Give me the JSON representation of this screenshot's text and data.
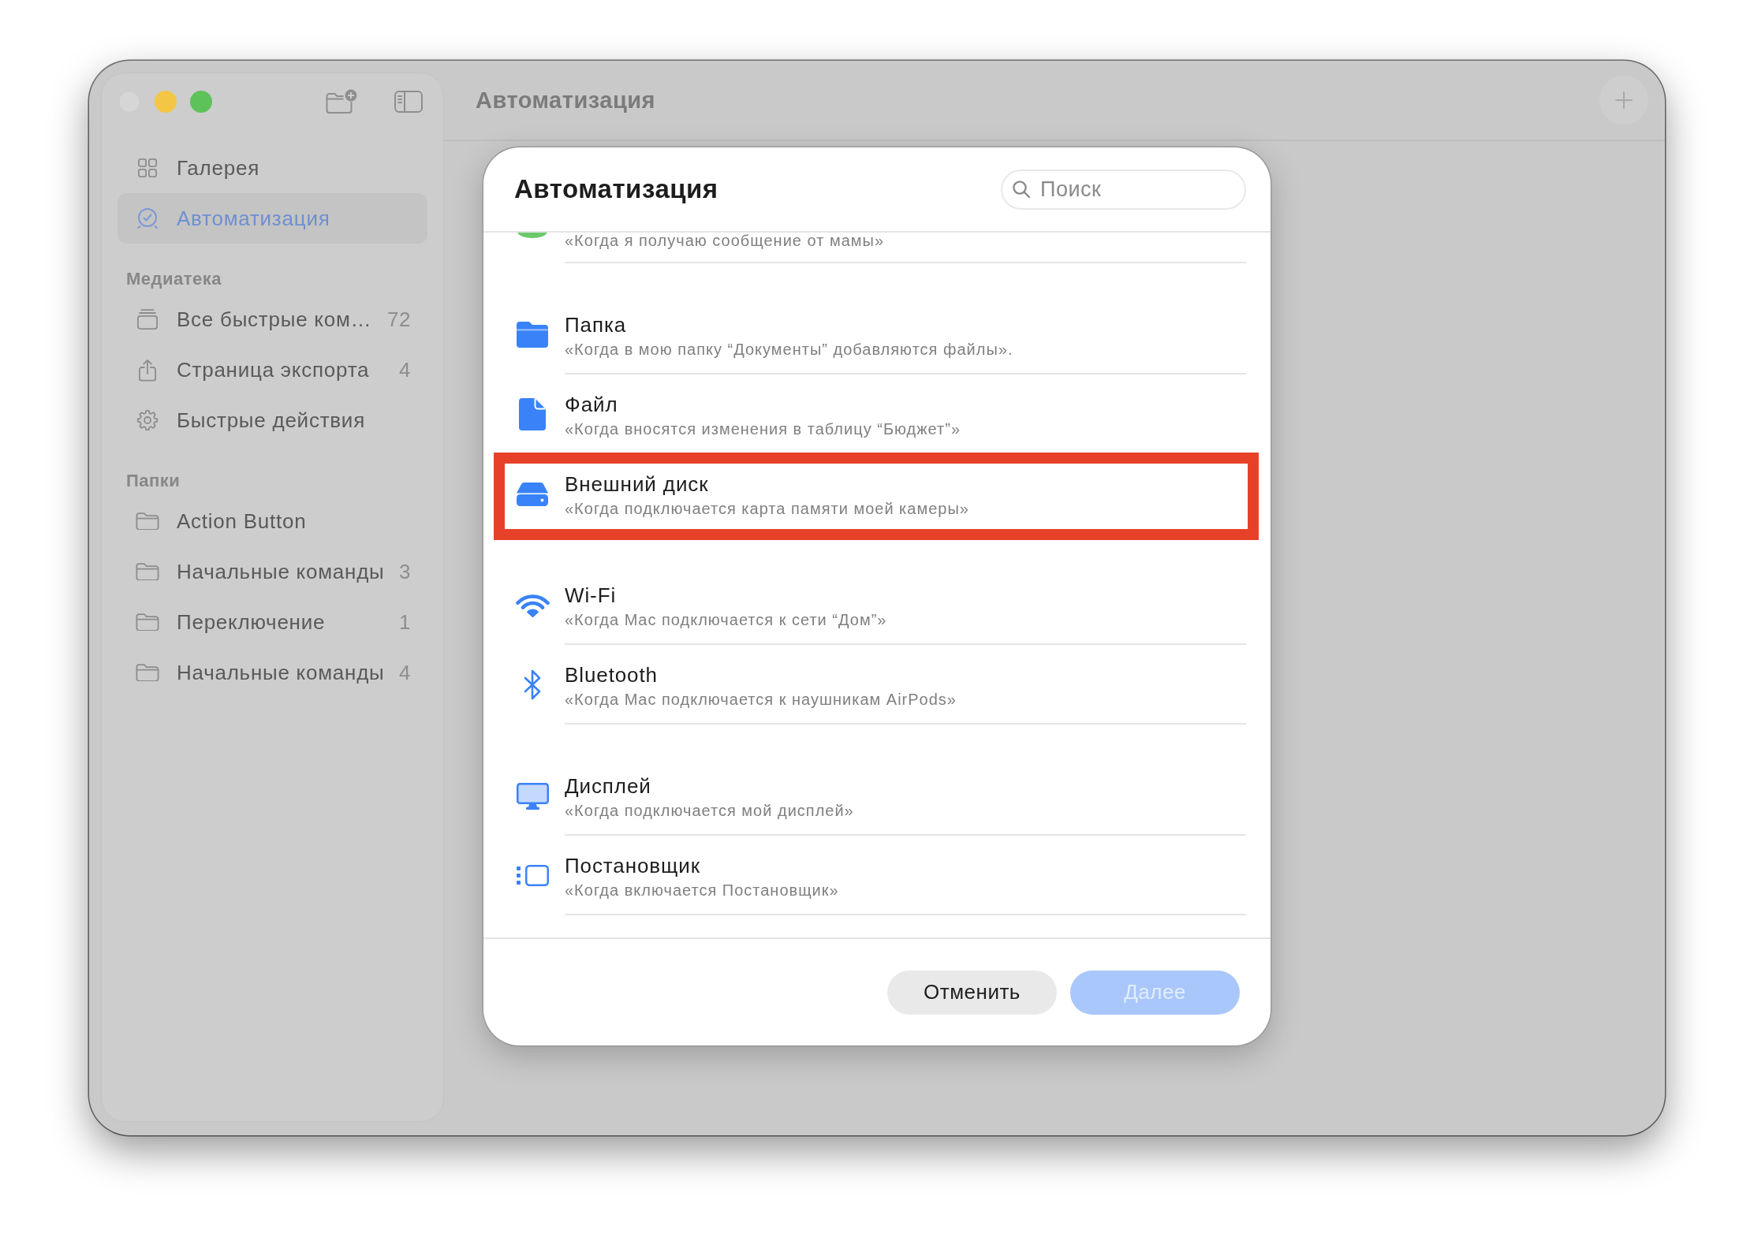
{
  "window": {
    "traffic_lights": [
      {
        "kind": "close",
        "disabled": true
      },
      {
        "kind": "minimize",
        "disabled": false
      },
      {
        "kind": "zoom",
        "disabled": false
      }
    ]
  },
  "sidebar": {
    "items": [
      {
        "kind": "gallery",
        "label": "Галерея",
        "selected": false
      },
      {
        "kind": "automation",
        "label": "Автоматизация",
        "selected": true
      }
    ],
    "sections": [
      {
        "title": "Медиатека",
        "items": [
          {
            "kind": "stack",
            "label": "Все быстрые ком…",
            "count": "72",
            "selected": false
          },
          {
            "kind": "share",
            "label": "Страница экспорта",
            "count": "4",
            "selected": false
          },
          {
            "kind": "gear",
            "label": "Быстрые действия",
            "selected": false
          }
        ]
      },
      {
        "title": "Папки",
        "items": [
          {
            "kind": "folder",
            "label": "Action Button",
            "selected": false
          },
          {
            "kind": "folder",
            "label": "Начальные команды",
            "count": "3",
            "selected": false
          },
          {
            "kind": "folder",
            "label": "Переключение",
            "count": "1",
            "selected": false
          },
          {
            "kind": "folder",
            "label": "Начальные команды",
            "count": "4",
            "selected": false
          }
        ]
      }
    ]
  },
  "toolbar": {
    "title": "Автоматизация"
  },
  "dialog": {
    "title": "Автоматизация",
    "search": {
      "placeholder": "Поиск"
    },
    "groups": [
      {
        "items": [
          {
            "kind": "message",
            "subtitle": "«Когда я получаю сообщение от мамы»",
            "highlighted": false
          }
        ]
      },
      {
        "items": [
          {
            "kind": "folder",
            "title": "Папка",
            "subtitle": "«Когда в мою папку “Документы” добавляются файлы».",
            "highlighted": false
          },
          {
            "kind": "file",
            "title": "Файл",
            "subtitle": "«Когда вносятся изменения в таблицу “Бюджет”»",
            "highlighted": false
          },
          {
            "kind": "disk",
            "title": "Внешний диск",
            "subtitle": "«Когда подключается карта памяти моей камеры»",
            "highlighted": true
          }
        ]
      },
      {
        "items": [
          {
            "kind": "wifi",
            "title": "Wi-Fi",
            "subtitle": "«Когда Mac подключается к сети “Дом”»",
            "highlighted": false
          },
          {
            "kind": "bluetooth",
            "title": "Bluetooth",
            "subtitle": "«Когда Mac подключается к наушникам AirPods»",
            "highlighted": false
          }
        ]
      },
      {
        "items": [
          {
            "kind": "display",
            "title": "Дисплей",
            "subtitle": "«Когда подключается мой дисплей»",
            "highlighted": false
          },
          {
            "kind": "stage",
            "title": "Постановщик",
            "subtitle": "«Когда включается Постановщик»",
            "highlighted": false
          }
        ]
      }
    ],
    "buttons": [
      {
        "kind": "cancel",
        "label": "Отменить",
        "disabled": false
      },
      {
        "kind": "next",
        "label": "Далее",
        "disabled": true
      }
    ]
  }
}
